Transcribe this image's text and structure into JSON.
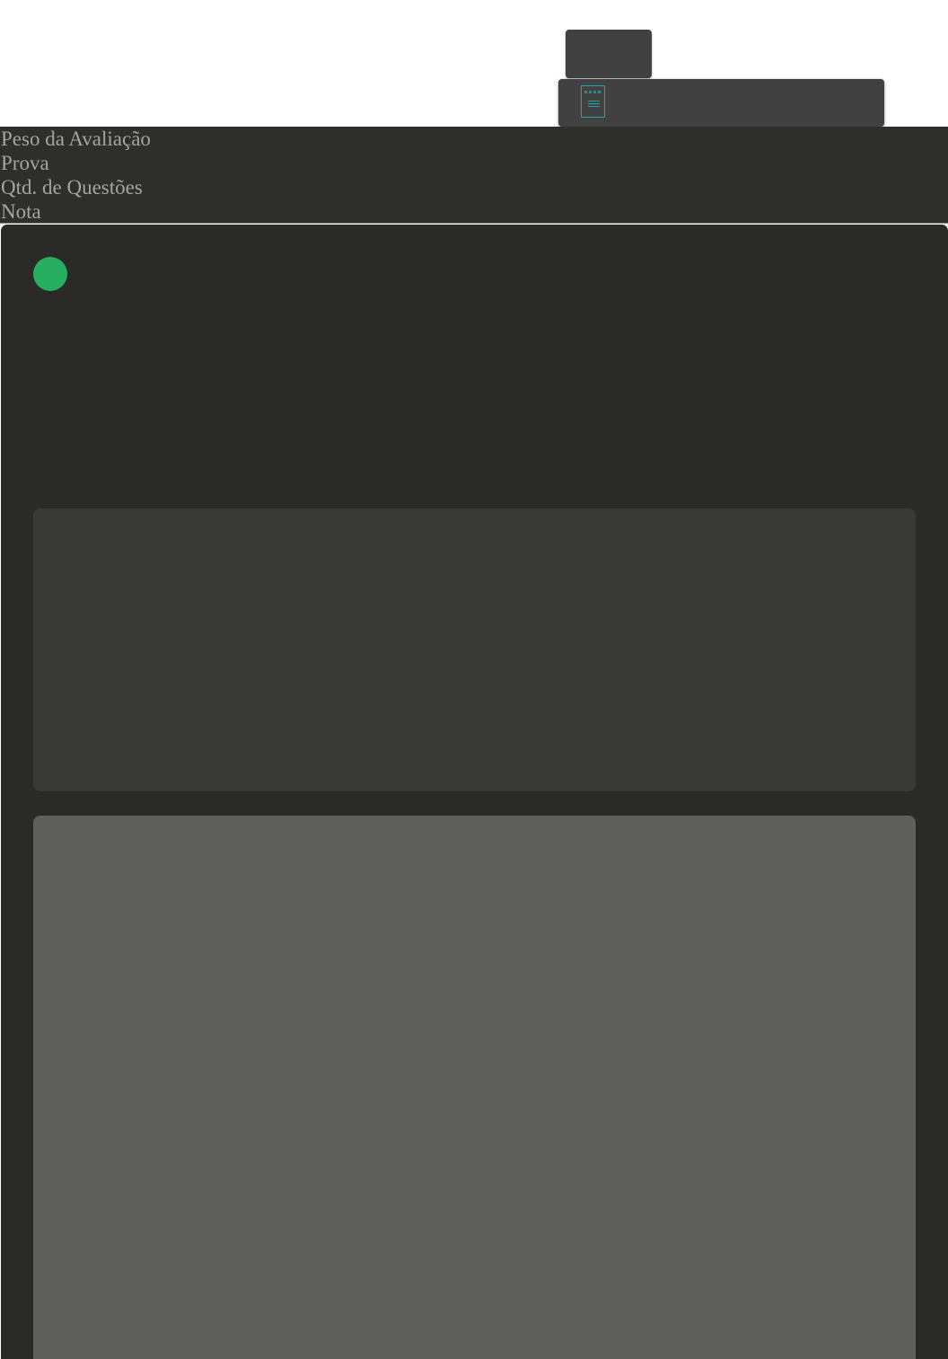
{
  "header_fields": [
    {
      "label": "Peso da Avaliação"
    },
    {
      "label": "Prova"
    },
    {
      "label": "Qtd. de Questões"
    },
    {
      "label": "Nota"
    }
  ],
  "toolbar": {
    "icon": "document-icon",
    "icon_color": "#1aa7a7"
  },
  "status": {
    "indicator_color": "#27ae60"
  }
}
